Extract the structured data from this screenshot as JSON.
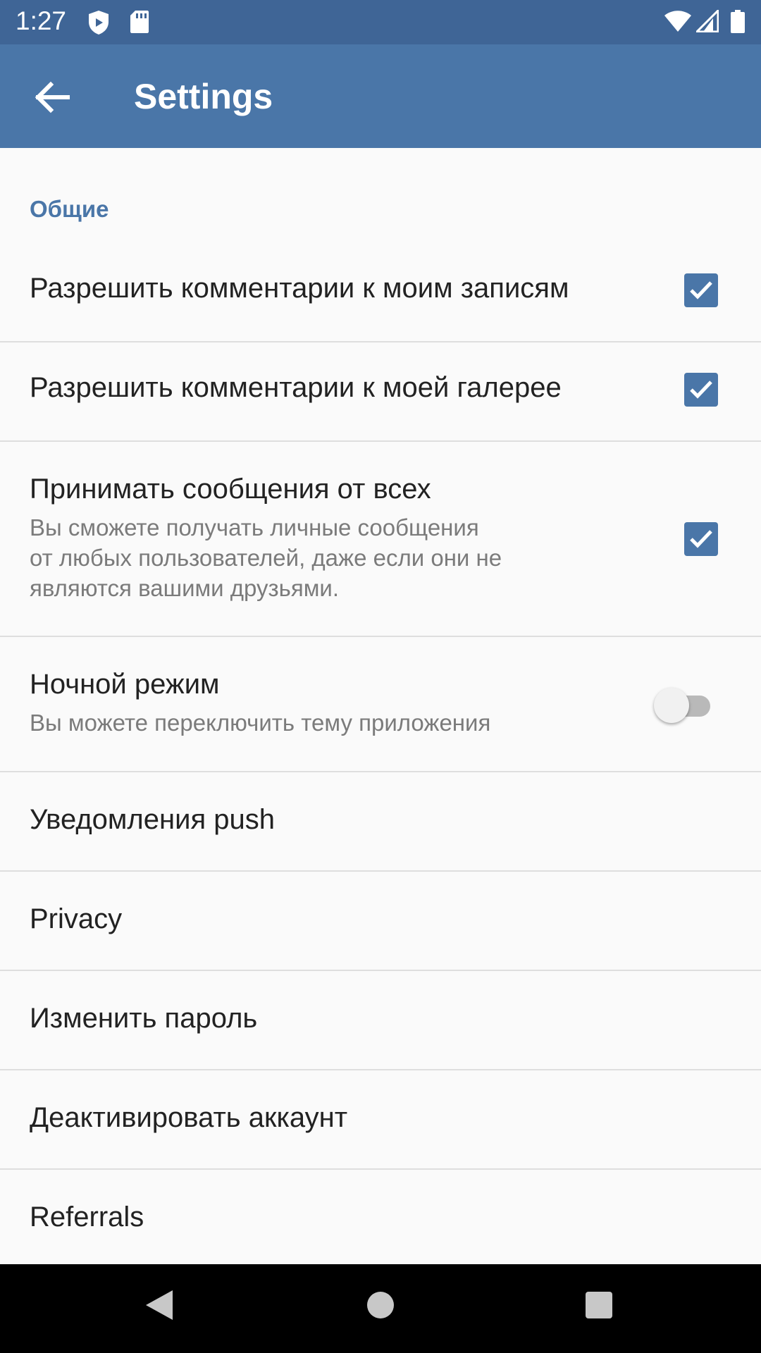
{
  "status_bar": {
    "time": "1:27",
    "icons": [
      "shield-icon",
      "sd-card-icon",
      "wifi-icon",
      "cell-signal-icon",
      "battery-icon"
    ],
    "background": "#3f6596"
  },
  "app_bar": {
    "title": "Settings",
    "back_icon": "arrow-back-icon",
    "background": "#4a76a8"
  },
  "settings": {
    "section_general": "Общие",
    "allow_comments_posts": {
      "title": "Разрешить комментарии к моим записям",
      "checked": true
    },
    "allow_comments_gallery": {
      "title": "Разрешить комментарии к моей галерее",
      "checked": true
    },
    "accept_messages": {
      "title": "Принимать сообщения от всех",
      "summary_line1": "Вы сможете получать личные сообщения",
      "summary_line2": "от любых пользователей, даже если они не",
      "summary_line3": "являются вашими друзьями.",
      "checked": true
    },
    "night_mode": {
      "title": "Ночной режим",
      "summary": "Вы можете переключить тему приложения",
      "enabled": false
    },
    "push_notifications": {
      "title": "Уведомления push"
    },
    "privacy": {
      "title": "Privacy"
    },
    "change_password": {
      "title": "Изменить пароль"
    },
    "deactivate_account": {
      "title": "Деактивировать аккаунт"
    },
    "referrals": {
      "title": "Referrals"
    }
  },
  "nav_bar": {
    "icons": [
      "back-triangle-icon",
      "home-circle-icon",
      "recents-square-icon"
    ]
  },
  "colors": {
    "accent": "#4a76a8",
    "text": "#222222",
    "summary_text": "#7b7b7b",
    "divider": "#dedede"
  }
}
